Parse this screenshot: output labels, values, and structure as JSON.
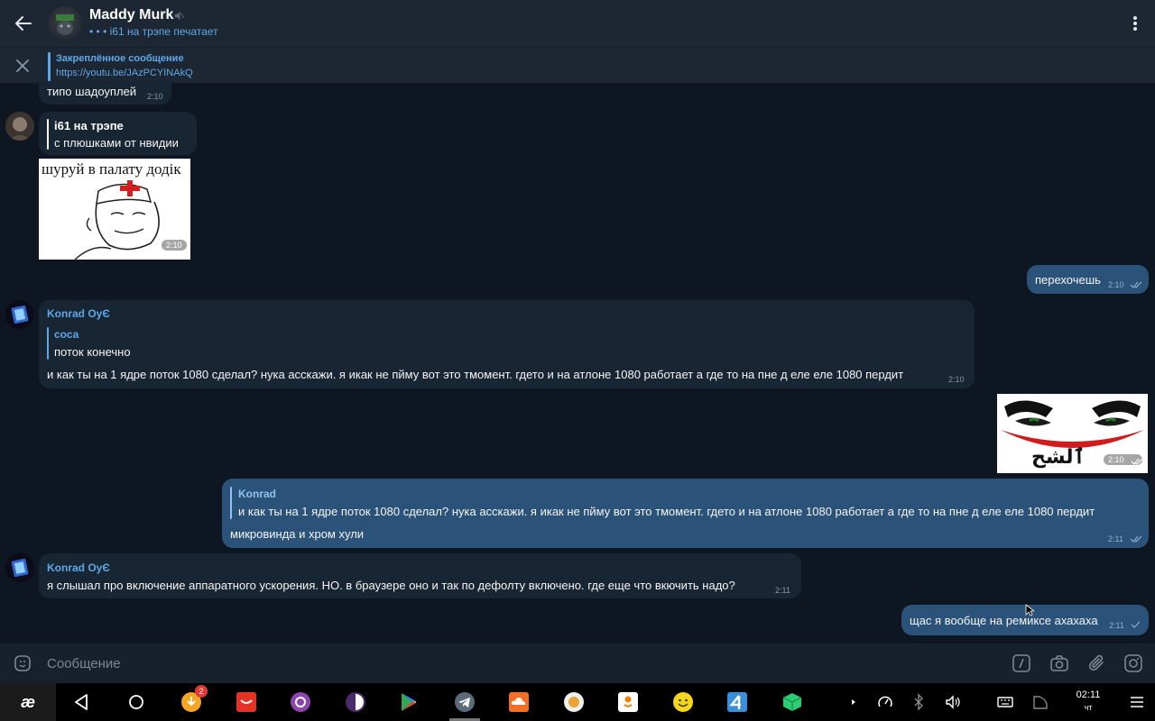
{
  "header": {
    "title": "Maddy Murk",
    "status": "• • • i61 на трэпе печатает"
  },
  "pinned": {
    "title": "Закреплённое сообщение",
    "text": "https://youtu.be/JAzPCYINAkQ"
  },
  "messages": {
    "m1": {
      "text": "типо шадоуплей",
      "time": "2:10"
    },
    "m2": {
      "reply_name": "i61 на трэпе",
      "reply_text": "с плюшками от нвидии"
    },
    "m3": {
      "sticker_text": "шуруй в палату додік",
      "time": "2:10"
    },
    "m4": {
      "text": "перехочешь",
      "time": "2:10"
    },
    "m5": {
      "sender": "Konrad OyЄ",
      "reply_name": "соса",
      "reply_text": "поток конечно",
      "text": "и как ты на 1 ядре поток 1080 сделал? нука асскажи. я икак не пйму вот это тмомент. гдето и на атлоне 1080 работает а где то на пне д еле еле 1080 пердит",
      "time": "2:10"
    },
    "m6": {
      "sticker_text": "ٱلشح",
      "time": "2:10"
    },
    "m7": {
      "reply_name": "Konrad",
      "reply_text": "и как ты на 1 ядре поток 1080 сделал? нука асскажи. я икак не пйму вот это тмомент. гдето и на атлоне 1080 работает а где то на пне д еле еле 1080 пердит",
      "text": "микровинда и хром хули",
      "time": "2:11"
    },
    "m8": {
      "sender": "Konrad OyЄ",
      "text": "я слышал про включение аппаратного ускорения. НО. в браузере оно и так по дефолту включено. где еще что вкючить надо?",
      "time": "2:11"
    },
    "m9": {
      "text": "щас я вообще на ремиксе ахахаха",
      "time": "2:11"
    }
  },
  "composer": {
    "placeholder": "Сообщение"
  },
  "taskbar": {
    "start_label": "æ",
    "badge": "2",
    "clock": "02:11",
    "day": "чт"
  },
  "colors": {
    "background": "#0e1621",
    "header": "#1d2733",
    "incoming": "#182533",
    "outgoing": "#2b5278",
    "accent": "#5fa8e8"
  }
}
